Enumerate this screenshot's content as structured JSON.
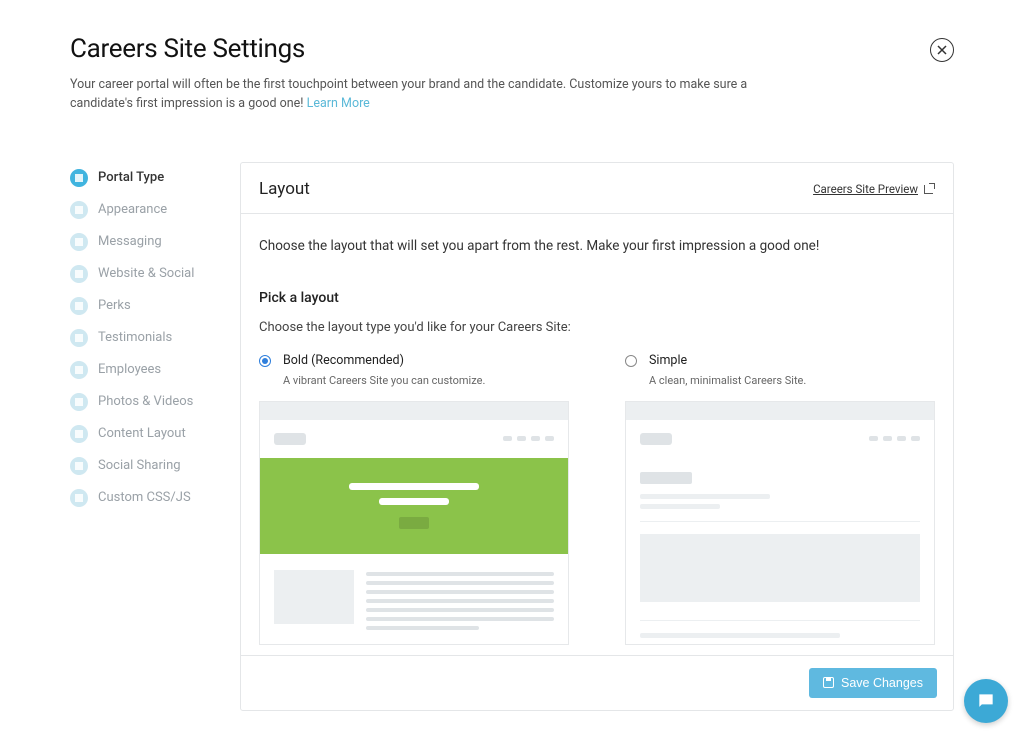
{
  "header": {
    "title": "Careers Site Settings",
    "subtitle_prefix": "Your career portal will often be the first touchpoint between your brand and the candidate. Customize yours to make sure a candidate's first impression is a good one! ",
    "learn_more": "Learn More"
  },
  "sidebar": {
    "items": [
      {
        "label": "Portal Type",
        "active": true
      },
      {
        "label": "Appearance",
        "active": false
      },
      {
        "label": "Messaging",
        "active": false
      },
      {
        "label": "Website & Social",
        "active": false
      },
      {
        "label": "Perks",
        "active": false
      },
      {
        "label": "Testimonials",
        "active": false
      },
      {
        "label": "Employees",
        "active": false
      },
      {
        "label": "Photos & Videos",
        "active": false
      },
      {
        "label": "Content Layout",
        "active": false
      },
      {
        "label": "Social Sharing",
        "active": false
      },
      {
        "label": "Custom CSS/JS",
        "active": false
      }
    ]
  },
  "panel": {
    "title": "Layout",
    "preview_link": "Careers Site Preview",
    "intro": "Choose the layout that will set you apart from the rest. Make your first impression a good one!",
    "section_heading": "Pick a layout",
    "section_sub": "Choose the layout type you'd like for your Careers Site:",
    "options": [
      {
        "label": "Bold (Recommended)",
        "desc": "A vibrant Careers Site you can customize.",
        "selected": true
      },
      {
        "label": "Simple",
        "desc": "A clean, minimalist Careers Site.",
        "selected": false
      }
    ],
    "save_label": "Save Changes"
  }
}
